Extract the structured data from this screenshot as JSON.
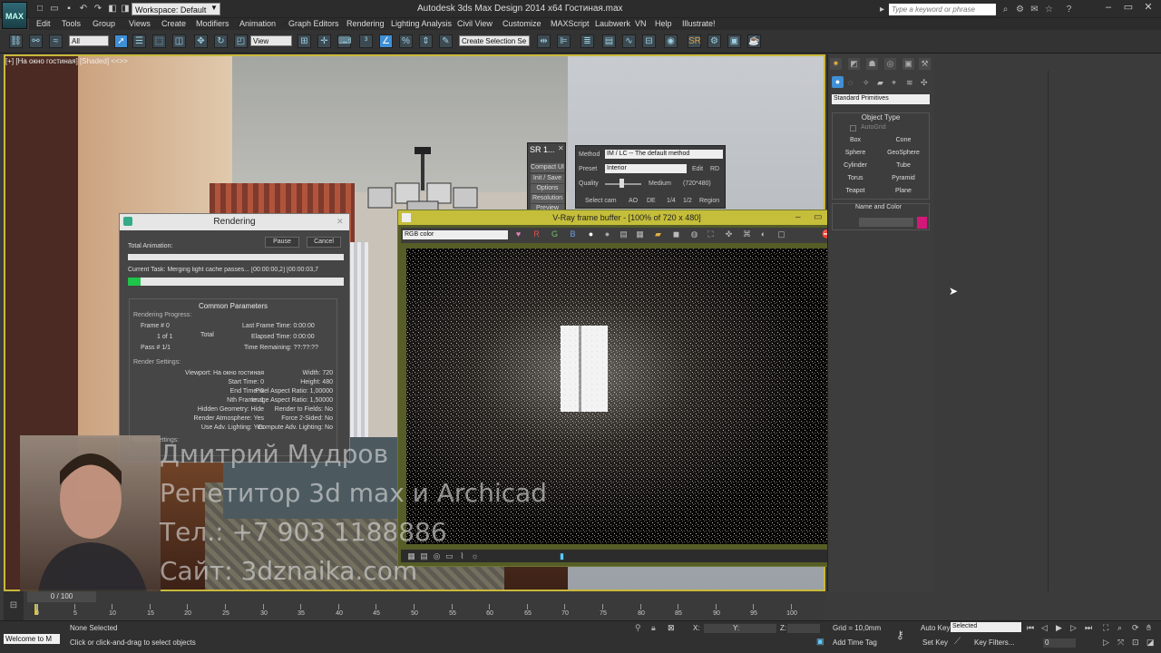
{
  "title_bar": {
    "workspace": "Workspace: Default",
    "window_title": "Autodesk 3ds Max Design 2014 x64        Гостиная.max",
    "search_placeholder": "Type a keyword or phrase"
  },
  "menu": [
    "Edit",
    "Tools",
    "Group",
    "Views",
    "Create",
    "Modifiers",
    "Animation",
    "Graph Editors",
    "Rendering",
    "Lighting Analysis",
    "Civil View",
    "Customize",
    "MAXScript",
    "Laubwerk",
    "VN",
    "Help",
    "Illustrate!"
  ],
  "toolbar": {
    "selection_filter": "All",
    "ref_coord": "View",
    "named_selection": "Create Selection Se"
  },
  "viewport": {
    "label": "[+] [На окно гостиная] [Shaded] <<>>"
  },
  "sr_panel": {
    "title": "SR 1...",
    "buttons": [
      "Compact UI",
      "Init / Save",
      "Options",
      "Resolution",
      "Preview"
    ]
  },
  "vray_sr": {
    "method_label": "Method",
    "method_value": "IM / LC -- The default method",
    "preset_label": "Preset",
    "preset_value": "Interior",
    "edit": "Edit",
    "rd": "RD",
    "quality_label": "Quality",
    "quality_value": "Medium",
    "resolution": "(720*480)",
    "buttons": [
      "Select cam",
      "AO",
      "DE",
      "1/4",
      "1/2",
      "Region"
    ]
  },
  "render_dialog": {
    "title": "Rendering",
    "pause": "Pause",
    "cancel": "Cancel",
    "total_animation": "Total Animation:",
    "current_task": "Current Task:  Merging light cache passes... [00:00:00,2] [00:00:03,7",
    "progress": 0.06,
    "common_params": "Common Parameters",
    "rendering_progress": "Rendering Progress:",
    "frame": "Frame #   0",
    "of": "1 of 1",
    "total": "Total",
    "pass": "Pass #  1/1",
    "last_frame": "Last Frame Time:  0:00:00",
    "elapsed": "Elapsed Time:  0:00:00",
    "remaining": "Time Remaining:  ??:??:??",
    "render_settings": "Render Settings:",
    "settings_left": [
      "Viewport: На окно гостиная",
      "Start Time: 0",
      "End Time: 0",
      "Nth Frame: 1",
      "Hidden Geometry: Hide",
      "Render Atmosphere: Yes",
      "Use Adv. Lighting: Yes"
    ],
    "settings_right": [
      "Width: 720",
      "Height: 480",
      "Pixel Aspect Ratio: 1,00000",
      "Image Aspect Ratio: 1,50000",
      "Render to Fields: No",
      "Force 2-Sided: No",
      "Compute Adv. Lighting: No"
    ],
    "output_settings": "Output Settings:"
  },
  "vfb": {
    "title": "V-Ray frame buffer - [100% of 720 x 480]",
    "channel": "RGB color",
    "tools": [
      "R",
      "G",
      "B"
    ]
  },
  "command_panel": {
    "category": "Standard Primitives",
    "object_type": "Object Type",
    "autogrid": "AutoGrid",
    "buttons": [
      "Box",
      "Cone",
      "Sphere",
      "GeoSphere",
      "Cylinder",
      "Tube",
      "Torus",
      "Pyramid",
      "Teapot",
      "Plane"
    ],
    "name_color": "Name and Color",
    "color": "#d4187a"
  },
  "overlay": {
    "name": "Дмитрий Мудров",
    "line1": "Репетитор 3d max и Archicad",
    "line2": "Тел.: +7 903 1188886",
    "line3": "Сайт: 3dznaika.com"
  },
  "timeline": {
    "frame": "0 / 100",
    "ticks": [
      "0",
      "5",
      "10",
      "15",
      "20",
      "25",
      "30",
      "35",
      "40",
      "45",
      "50",
      "55",
      "60",
      "65",
      "70",
      "75",
      "80",
      "85",
      "90",
      "95",
      "100"
    ]
  },
  "status": {
    "welcome": "Welcome to M",
    "none_selected": "None Selected",
    "prompt": "Click or click-and-drag to select objects",
    "x": "X:",
    "y": "Y:",
    "z": "Z:",
    "grid": "Grid = 10,0mm",
    "add_time_tag": "Add Time Tag",
    "auto_key": "Auto Key",
    "selected": "Selected",
    "set_key": "Set Key",
    "key_filters": "Key Filters...",
    "frame": "0"
  }
}
